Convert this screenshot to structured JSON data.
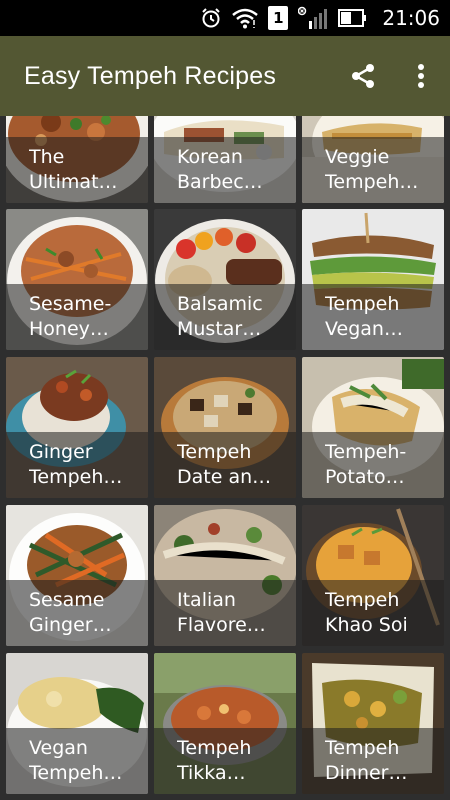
{
  "status_bar": {
    "time": "21:06",
    "icons": [
      "alarm-icon",
      "wifi-icon",
      "sim-1-icon",
      "signal-icon",
      "battery-icon"
    ],
    "sim_label": "1"
  },
  "app_bar": {
    "title": "Easy Tempeh Recipes",
    "background": "#535733",
    "actions": [
      "share-icon",
      "more-vert-icon"
    ]
  },
  "recipes": [
    {
      "line1": "The",
      "line2": "Ultimat…"
    },
    {
      "line1": "Korean",
      "line2": "Barbec…"
    },
    {
      "line1": "Veggie",
      "line2": "Tempeh…"
    },
    {
      "line1": "Sesame-",
      "line2": "Honey…"
    },
    {
      "line1": "Balsamic",
      "line2": "Mustar…"
    },
    {
      "line1": "Tempeh",
      "line2": "Vegan…"
    },
    {
      "line1": "Ginger",
      "line2": "Tempeh…"
    },
    {
      "line1": "Tempeh",
      "line2": "Date an…"
    },
    {
      "line1": "Tempeh-",
      "line2": "Potato…"
    },
    {
      "line1": "Sesame",
      "line2": "Ginger…"
    },
    {
      "line1": "Italian",
      "line2": "Flavore…"
    },
    {
      "line1": "Tempeh",
      "line2": "Khao Soi"
    },
    {
      "line1": "Vegan",
      "line2": "Tempeh…"
    },
    {
      "line1": "Tempeh",
      "line2": "Tikka…"
    },
    {
      "line1": "Tempeh",
      "line2": "Dinner…"
    }
  ]
}
